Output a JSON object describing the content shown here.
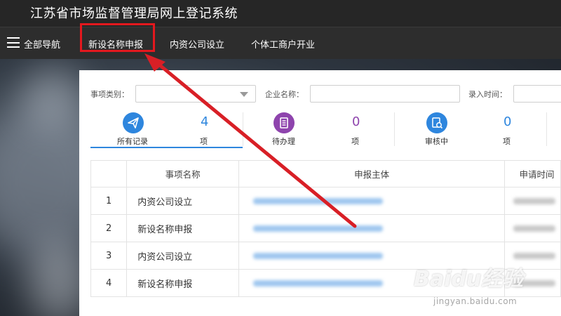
{
  "app": {
    "title": "江苏省市场监督管理局网上登记系统"
  },
  "nav": {
    "all_nav": "全部导航",
    "items": [
      "新设名称申报",
      "内资公司设立",
      "个体工商户开业"
    ]
  },
  "filters": {
    "category_label": "事项类别：",
    "category_value": "",
    "company_label": "企业名称：",
    "company_value": "",
    "entry_time_label": "录入时间："
  },
  "stats": [
    {
      "label": "所有记录",
      "count": "4",
      "unit": "项",
      "color": "#2e86de",
      "icon": "send-icon"
    },
    {
      "label": "待办理",
      "count": "0",
      "unit": "项",
      "color": "#8e44ad",
      "icon": "document-icon"
    },
    {
      "label": "审核中",
      "count": "0",
      "unit": "项",
      "color": "#2e86de",
      "icon": "review-icon"
    }
  ],
  "table": {
    "headers": [
      "事项名称",
      "申报主体",
      "申请时间"
    ],
    "rows": [
      {
        "idx": "1",
        "name": "内资公司设立"
      },
      {
        "idx": "2",
        "name": "新设名称申报"
      },
      {
        "idx": "3",
        "name": "内资公司设立"
      },
      {
        "idx": "4",
        "name": "新设名称申报"
      }
    ]
  },
  "watermark": {
    "text": "Baidu经验",
    "sub": "jingyan.baidu.com"
  },
  "colors": {
    "highlight": "#e3181e",
    "accent": "#2e86de",
    "purple": "#8e44ad"
  }
}
